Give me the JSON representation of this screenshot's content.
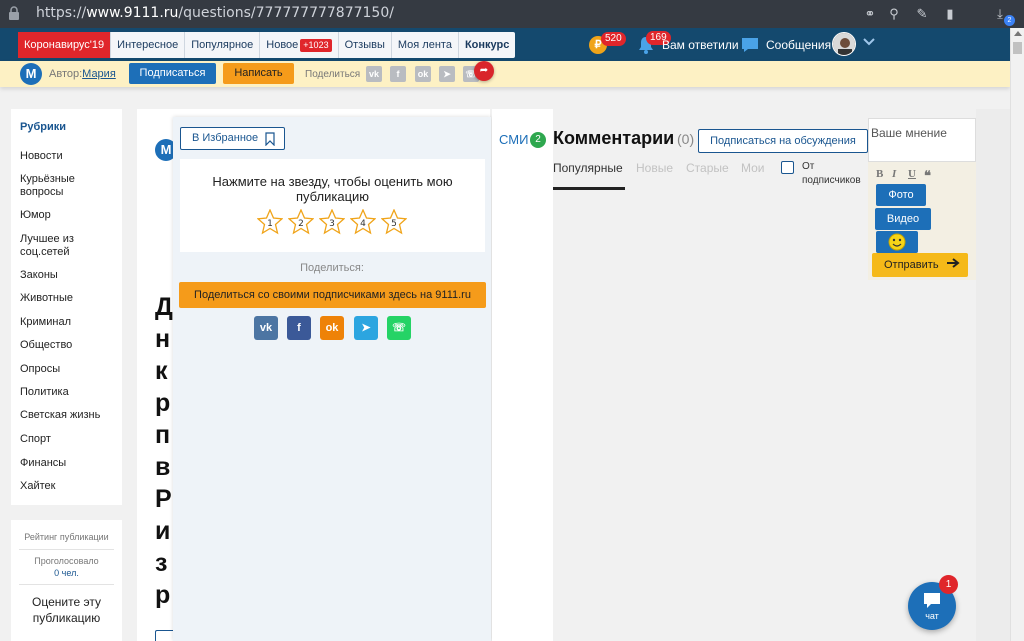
{
  "browser": {
    "url_prefix": "https://",
    "url_domain": "www.9111.ru",
    "url_path": "/questions/777777777877150/",
    "download_count": "2"
  },
  "nav": {
    "tabs": [
      {
        "label": "Коронавирус'19"
      },
      {
        "label": "Интересное"
      },
      {
        "label": "Популярное"
      },
      {
        "label": "Новое",
        "badge": "+1023"
      },
      {
        "label": "Отзывы"
      },
      {
        "label": "Моя лента"
      },
      {
        "label": "Конкурс"
      }
    ],
    "coins_badge": "520",
    "bell_badge": "169",
    "answers_label": "Вам ответили",
    "messages_label": "Сообщения"
  },
  "author_bar": {
    "logo_letter": "M",
    "author_prefix": "Автор:",
    "author_name": "Мария",
    "subscribe_label": "Подписаться",
    "write_label": "Написать",
    "share_label": "Поделиться"
  },
  "sidebar": {
    "heading": "Рубрики",
    "items": [
      {
        "label": "Новости"
      },
      {
        "label": "Курьёзные вопросы"
      },
      {
        "label": "Юмор"
      },
      {
        "label": "Лучшее из соц.сетей"
      },
      {
        "label": "Законы"
      },
      {
        "label": "Животные"
      },
      {
        "label": "Криминал"
      },
      {
        "label": "Общество"
      },
      {
        "label": "Опросы"
      },
      {
        "label": "Политика"
      },
      {
        "label": "Светская жизнь"
      },
      {
        "label": "Спорт"
      },
      {
        "label": "Финансы"
      },
      {
        "label": "Хайтек"
      }
    ]
  },
  "rating": {
    "title": "Рейтинг публикации",
    "voted_label": "Проголосовало",
    "voted_count": "0 чел.",
    "rate_prompt": "Оцените эту публикацию"
  },
  "article": {
    "logo_letter": "M",
    "title_fragment": "Д\nн\nк\nр\nп\nв\nР\nи\nз\nр"
  },
  "dropdown": {
    "favorite_label": "В Избранное",
    "rate_text": "Нажмите на звезду, чтобы оценить мою публикацию",
    "stars": [
      "1",
      "2",
      "3",
      "4",
      "5"
    ],
    "share_title": "Поделиться:",
    "share_followers_label": "Поделиться со своими подписчиками здесь на 9111.ru"
  },
  "smi": {
    "label": "СМИ",
    "count": "2"
  },
  "comments": {
    "title": "Комментарии",
    "count": "(0)",
    "subscribe_label": "Подписаться на обсуждения",
    "tabs": [
      {
        "label": "Популярные"
      },
      {
        "label": "Новые"
      },
      {
        "label": "Старые"
      },
      {
        "label": "Мои"
      }
    ],
    "from_followers_label": "От подписчиков"
  },
  "editor": {
    "placeholder": "Ваше мнение",
    "photo_label": "Фото",
    "video_label": "Видео",
    "send_label": "Отправить"
  },
  "chat": {
    "label": "чат",
    "badge": "1"
  },
  "colors": {
    "nav_bg": "#14496e",
    "accent_blue": "#1d6fb8",
    "accent_orange": "#f59b1a",
    "badge_red": "#e0262b",
    "author_bar_bg": "#fdf1c4"
  }
}
